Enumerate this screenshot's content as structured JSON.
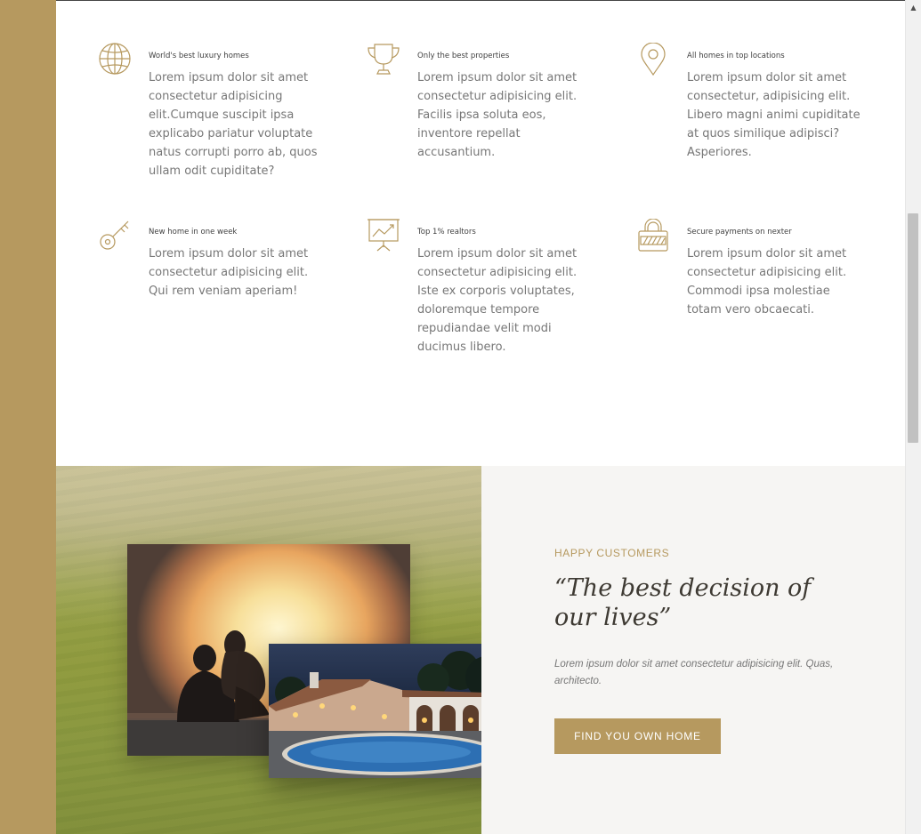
{
  "features": [
    {
      "title": "World's best luxury homes",
      "icon": "globe-icon",
      "text": "Lorem ipsum dolor sit amet consectetur adipisicing elit.Cumque suscipit ipsa explicabo pariatur voluptate natus corrupti porro ab, quos ullam odit cupiditate?"
    },
    {
      "title": "Only the best properties",
      "icon": "trophy-icon",
      "text": "Lorem ipsum dolor sit amet consectetur adipisicing elit. Facilis ipsa soluta eos, inventore repellat accusantium."
    },
    {
      "title": "All homes in top locations",
      "icon": "map-pin-icon",
      "text": "Lorem ipsum dolor sit amet consectetur, adipisicing elit. Libero magni animi cupiditate at quos similique adipisci? Asperiores."
    },
    {
      "title": "New home in one week",
      "icon": "key-icon",
      "text": "Lorem ipsum dolor sit amet consectetur adipisicing elit. Qui rem veniam aperiam!"
    },
    {
      "title": "Top 1% realtors",
      "icon": "presentation-chart-icon",
      "text": "Lorem ipsum dolor sit amet consectetur adipisicing elit. Iste ex corporis voluptates, doloremque tempore repudiandae velit modi ducimus libero."
    },
    {
      "title": "Secure payments on nexter",
      "icon": "lock-icon",
      "text": "Lorem ipsum dolor sit amet consectetur adipisicing elit. Commodi ipsa molestiae totam vero obcaecati."
    }
  ],
  "testimonial": {
    "eyebrow": "HAPPY CUSTOMERS",
    "quote": "“The best decision of our lives”",
    "text": "Lorem ipsum dolor sit amet consectetur adipisicing elit. Quas, architecto.",
    "button_label": "FIND YOU OWN HOME"
  },
  "colors": {
    "accent": "#b6995f",
    "light_bg": "#f6f5f3",
    "heading": "#3e3a33"
  }
}
